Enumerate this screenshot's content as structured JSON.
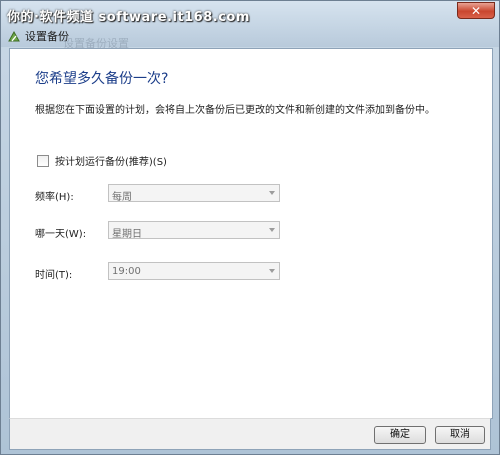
{
  "watermark": "你的·软件频道 software.it168.com",
  "window": {
    "title": "设置备份",
    "ghost_title": "设置备份设置",
    "close_label": "✕"
  },
  "page": {
    "heading": "您希望多久备份一次?",
    "description": "根据您在下面设置的计划，会将自上次备份后已更改的文件和新创建的文件添加到备份中。"
  },
  "schedule": {
    "checkbox_label": "按计划运行备份(推荐)(S)",
    "checked": false
  },
  "fields": {
    "frequency": {
      "label": "频率(H):",
      "value": "每周"
    },
    "day": {
      "label": "哪一天(W):",
      "value": "星期日"
    },
    "time": {
      "label": "时间(T):",
      "value": "19:00"
    }
  },
  "buttons": {
    "ok": "确定",
    "cancel": "取消"
  },
  "icons": {
    "app": "backup-icon",
    "close": "close-icon",
    "dropdown": "chevron-down-icon"
  }
}
